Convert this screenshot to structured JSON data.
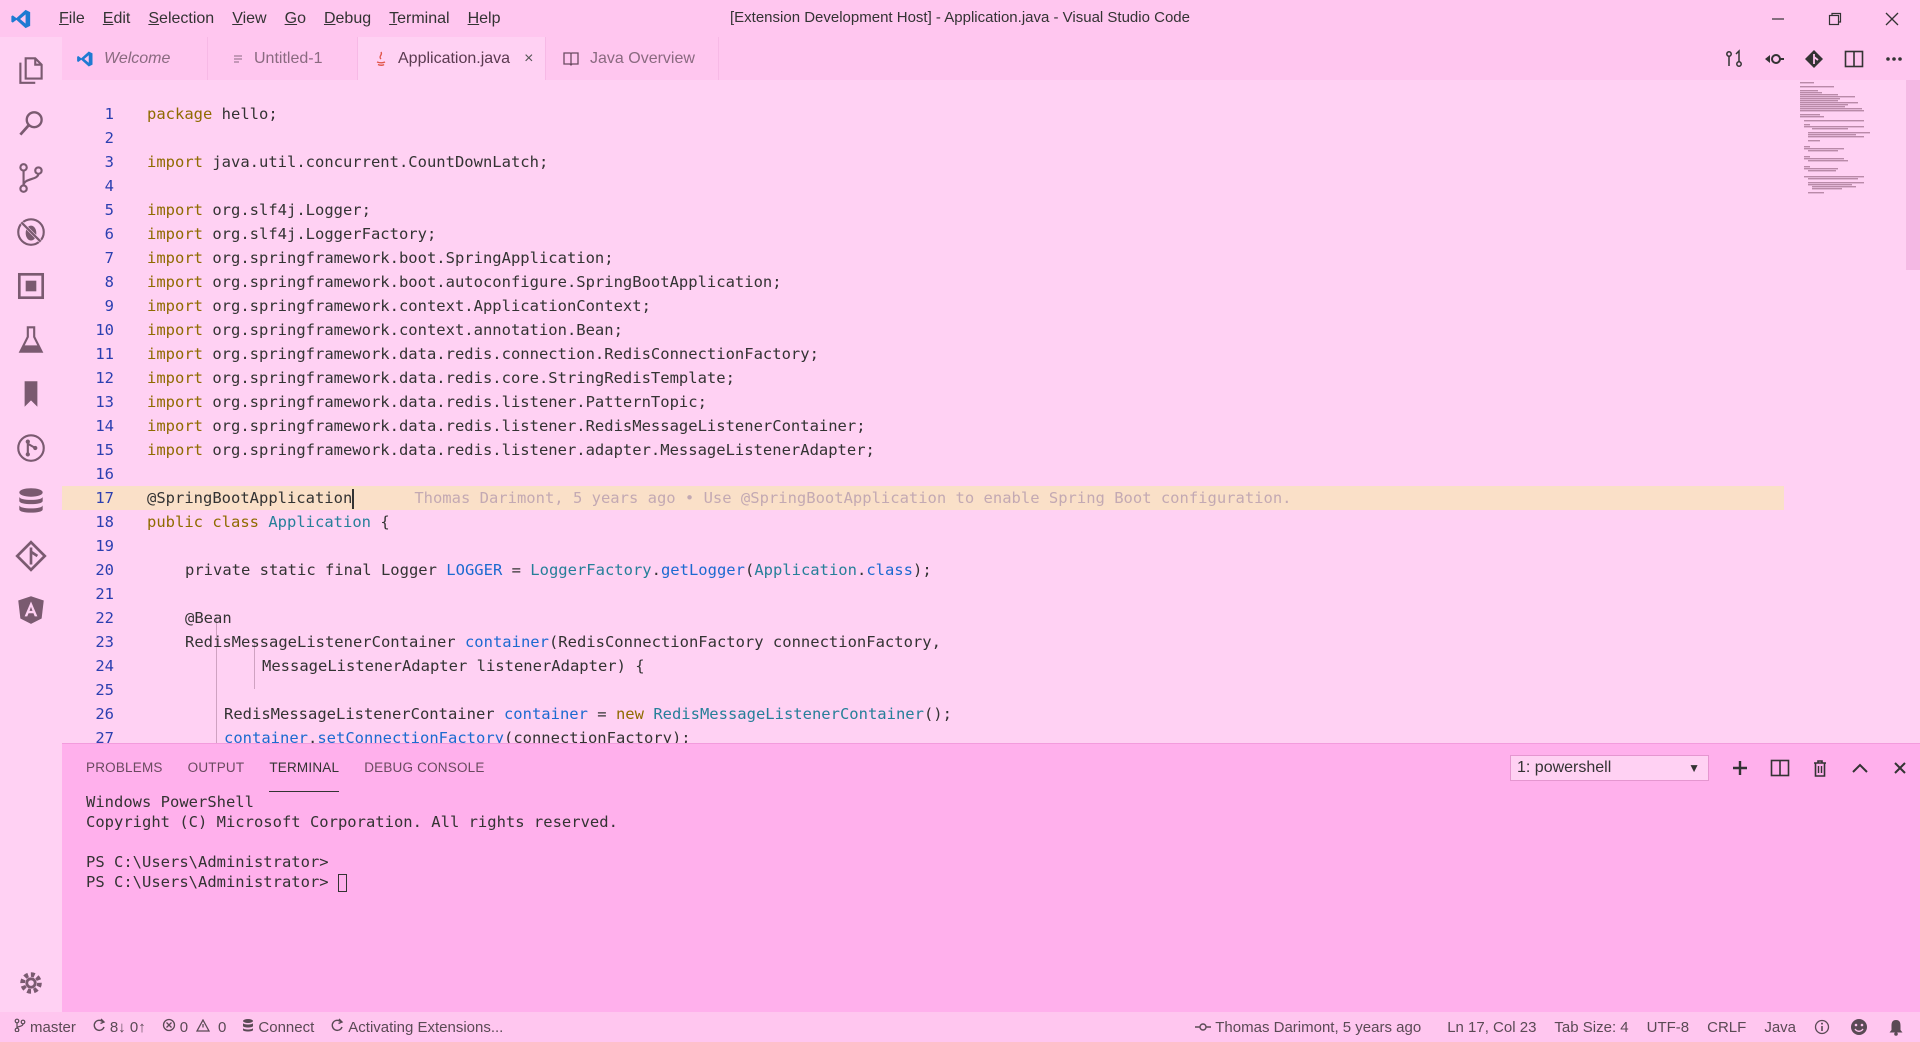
{
  "window": {
    "title": "[Extension Development Host] - Application.java - Visual Studio Code",
    "menu": [
      {
        "ul": "F",
        "rest": "ile"
      },
      {
        "ul": "E",
        "rest": "dit"
      },
      {
        "ul": "S",
        "rest": "election"
      },
      {
        "ul": "V",
        "rest": "iew"
      },
      {
        "ul": "G",
        "rest": "o"
      },
      {
        "ul": "D",
        "rest": "ebug"
      },
      {
        "ul": "T",
        "rest": "erminal"
      },
      {
        "ul": "H",
        "rest": "elp"
      }
    ]
  },
  "tabs": [
    {
      "label": "Welcome",
      "icon": "vscode-icon"
    },
    {
      "label": "Untitled-1",
      "icon": "file-icon"
    },
    {
      "label": "Application.java",
      "icon": "java-icon",
      "close": "×"
    },
    {
      "label": "Java Overview",
      "icon": "book-icon"
    }
  ],
  "editor": {
    "line_numbers": [
      "1",
      "2",
      "3",
      "4",
      "5",
      "6",
      "7",
      "8",
      "9",
      "10",
      "11",
      "12",
      "13",
      "14",
      "15",
      "16",
      "17",
      "18",
      "19",
      "20",
      "21",
      "22",
      "23",
      "24",
      "25",
      "26",
      "27"
    ],
    "l1": {
      "kw": "package",
      "rest": " hello;"
    },
    "l3": {
      "kw": "import",
      "rest": " java.util.concurrent.CountDownLatch;"
    },
    "l5": {
      "kw": "import",
      "rest": " org.slf4j.Logger;"
    },
    "l6": {
      "kw": "import",
      "rest": " org.slf4j.LoggerFactory;"
    },
    "l7": {
      "kw": "import",
      "rest": " org.springframework.boot.SpringApplication;"
    },
    "l8": {
      "kw": "import",
      "rest": " org.springframework.boot.autoconfigure.SpringBootApplication;"
    },
    "l9": {
      "kw": "import",
      "rest": " org.springframework.context.ApplicationContext;"
    },
    "l10": {
      "kw": "import",
      "rest": " org.springframework.context.annotation.Bean;"
    },
    "l11": {
      "kw": "import",
      "rest": " org.springframework.data.redis.connection.RedisConnectionFactory;"
    },
    "l12": {
      "kw": "import",
      "rest": " org.springframework.data.redis.core.StringRedisTemplate;"
    },
    "l13": {
      "kw": "import",
      "rest": " org.springframework.data.redis.listener.PatternTopic;"
    },
    "l14": {
      "kw": "import",
      "rest": " org.springframework.data.redis.listener.RedisMessageListenerContainer;"
    },
    "l15": {
      "kw": "import",
      "rest": " org.springframework.data.redis.listener.adapter.MessageListenerAdapter;"
    },
    "l17": {
      "annot": "@SpringBootApplication",
      "blame": "Thomas Darimont, 5 years ago • Use @SpringBootApplication to enable Spring Boot configuration."
    },
    "l18": {
      "kw": "public class",
      "cls": "Application",
      "rest": " {"
    },
    "l20": {
      "a": "private static final Logger ",
      "b": "LOGGER",
      "c": " = ",
      "d": "LoggerFactory",
      "e": ".",
      "f": "getLogger",
      "g": "(",
      "h": "Application",
      "i": ".",
      "j": "class",
      "k": ");"
    },
    "l22": {
      "text": "@Bean"
    },
    "l23": {
      "a": "RedisMessageListenerContainer ",
      "b": "container",
      "c": "(RedisConnectionFactory connectionFactory,"
    },
    "l24": {
      "text": "MessageListenerAdapter listenerAdapter) {"
    },
    "l26": {
      "a": "RedisMessageListenerContainer ",
      "b": "container",
      "c": " = ",
      "d": "new",
      "e": " ",
      "f": "RedisMessageListenerContainer",
      "g": "();"
    },
    "l27": {
      "a": "container",
      "b": ".",
      "c": "setConnectionFactory",
      "d": "(connectionFactory);"
    }
  },
  "panel": {
    "tabs": [
      "PROBLEMS",
      "OUTPUT",
      "TERMINAL",
      "DEBUG CONSOLE"
    ],
    "terminal_select": "1: powershell",
    "terminal_lines": [
      "Windows PowerShell",
      "Copyright (C) Microsoft Corporation. All rights reserved.",
      "",
      "PS C:\\Users\\Administrator>",
      "PS C:\\Users\\Administrator> "
    ]
  },
  "status": {
    "branch": "master",
    "sync": "8↓ 0↑",
    "errors": "0",
    "warnings": "0",
    "connect": "Connect",
    "activity": "Activating Extensions...",
    "blame": "Thomas Darimont, 5 years ago",
    "position": "Ln 17, Col 23",
    "tab_size": "Tab Size: 4",
    "encoding": "UTF-8",
    "eol": "CRLF",
    "language": "Java"
  },
  "colors": {
    "accent": "#1c6ad0",
    "keyword": "#8f6b00",
    "background": "#ffd1f3"
  }
}
